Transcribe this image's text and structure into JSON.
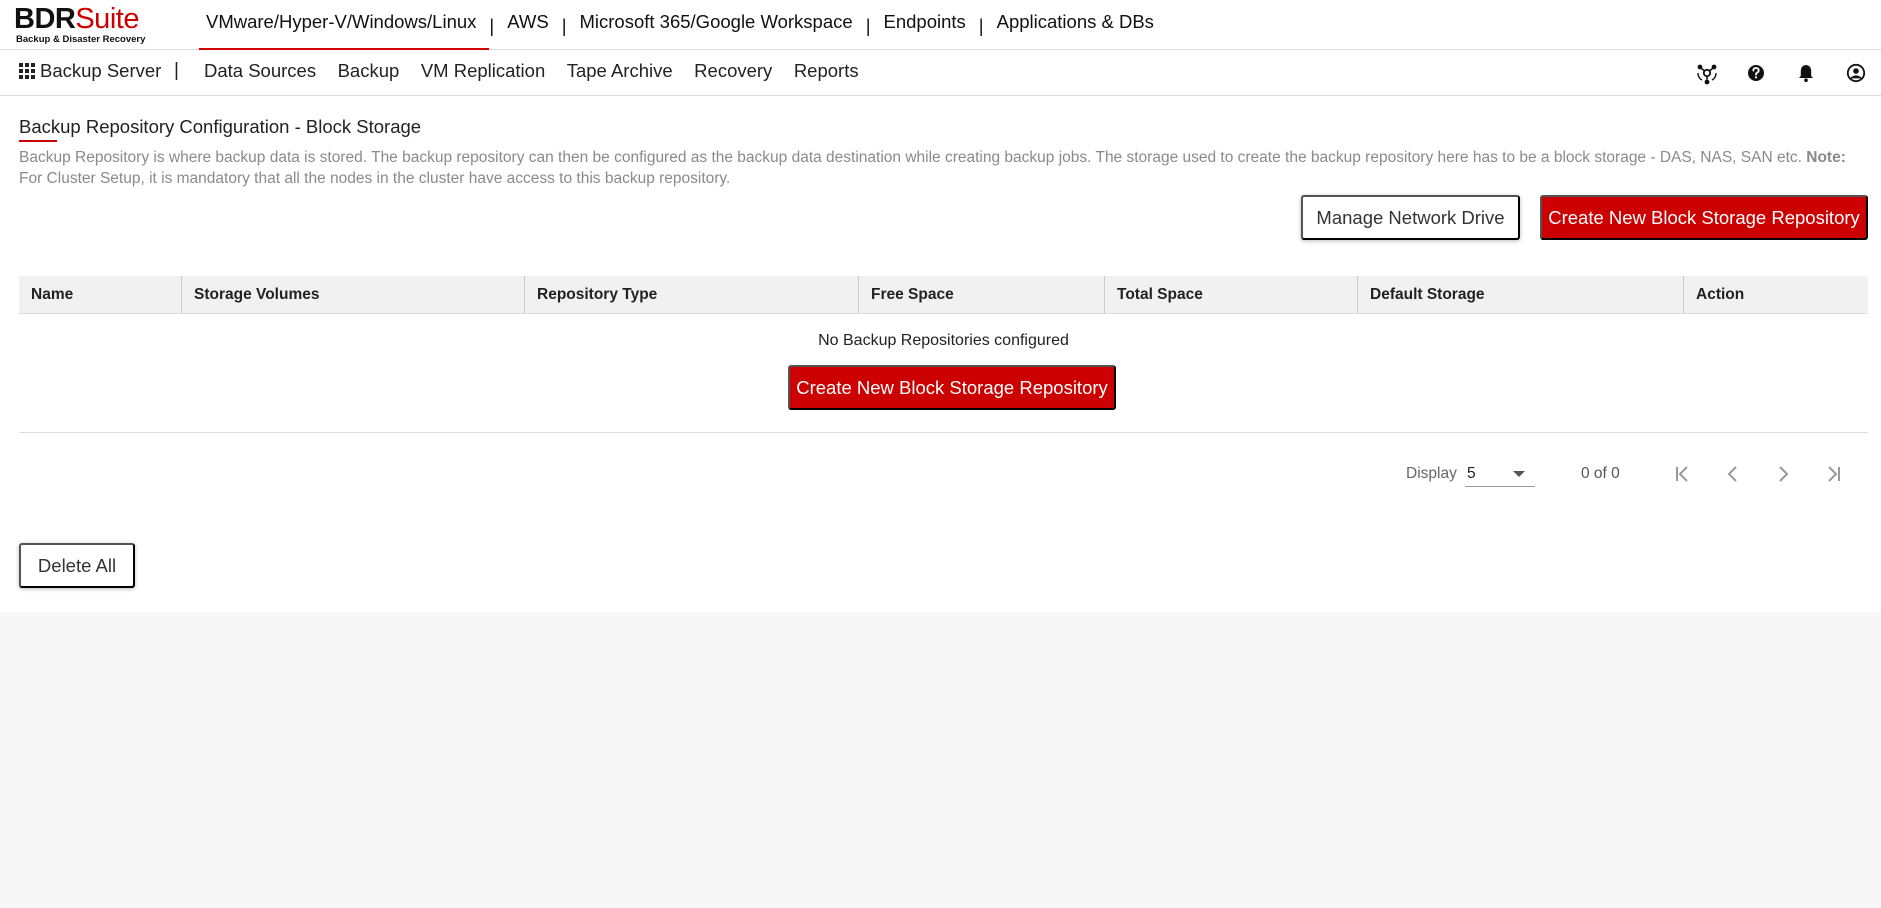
{
  "brand": {
    "logo_main_left": "BDR",
    "logo_main_right": "Suite",
    "logo_sub": "Backup & Disaster Recovery"
  },
  "product_nav": {
    "items": [
      {
        "label": "VMware/Hyper-V/Windows/Linux",
        "active": true
      },
      {
        "label": "AWS"
      },
      {
        "label": "Microsoft 365/Google Workspace"
      },
      {
        "label": "Endpoints"
      },
      {
        "label": "Applications & DBs"
      }
    ],
    "separator": "|"
  },
  "subnav": {
    "apps_label": "Backup Server",
    "separator": "|",
    "items": [
      {
        "label": "Data Sources"
      },
      {
        "label": "Backup"
      },
      {
        "label": "VM Replication"
      },
      {
        "label": "Tape Archive"
      },
      {
        "label": "Recovery"
      },
      {
        "label": "Reports"
      }
    ],
    "icons": [
      "cluster-icon",
      "help-icon",
      "bell-icon",
      "user-icon"
    ]
  },
  "page": {
    "title": "Backup Repository Configuration - Block Storage",
    "description": "Backup Repository is where backup data is stored. The backup repository can then be configured as the backup data destination while creating backup jobs. The storage used to create the backup repository here has to be a block storage - DAS, NAS, SAN etc. ",
    "note_label": "Note:",
    "note_text": " For Cluster Setup, it is mandatory that all the nodes in the cluster have access to this backup repository."
  },
  "actions": {
    "manage_network_drive": "Manage Network Drive",
    "create_repo": "Create New Block Storage Repository",
    "delete_all": "Delete All"
  },
  "table": {
    "columns": [
      "Name",
      "Storage Volumes",
      "Repository Type",
      "Free Space",
      "Total Space",
      "Default Storage",
      "Action"
    ],
    "rows": [],
    "empty_message": "No Backup Repositories configured",
    "empty_action": "Create New Block Storage Repository"
  },
  "pagination": {
    "display_label": "Display",
    "page_size": "5",
    "count_text": "0 of 0"
  },
  "colors": {
    "accent": "#cc0000",
    "header_bg": "#f1f1f1",
    "muted_text": "#8a8a8a"
  }
}
